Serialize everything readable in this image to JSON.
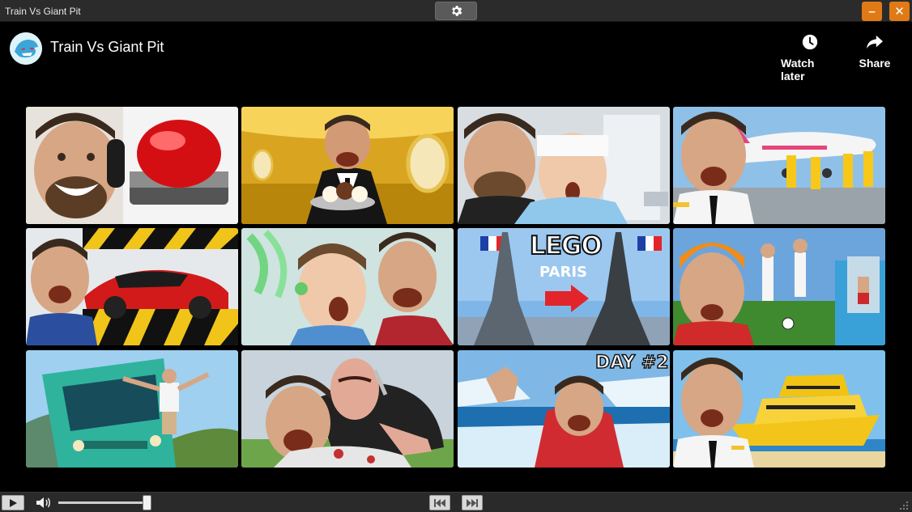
{
  "window": {
    "title": "Train Vs Giant Pit",
    "settings_icon": "gear-icon",
    "minimize_label": "–",
    "close_label": "✕",
    "accent_color": "#e07a16"
  },
  "player": {
    "video_title": "Train Vs Giant Pit",
    "actions": {
      "watch_later_label": "Watch later",
      "share_label": "Share"
    },
    "thumbnails": [
      {
        "icon": "red-button-thumbnail"
      },
      {
        "icon": "golden-jet-thumbnail"
      },
      {
        "icon": "hospital-thumbnail"
      },
      {
        "icon": "private-jet-thumbnail"
      },
      {
        "icon": "lamborghini-press-thumbnail"
      },
      {
        "icon": "hearing-aid-thumbnail"
      },
      {
        "icon": "lego-paris-thumbnail",
        "text_main": "LEGO",
        "text_sub": "PARIS"
      },
      {
        "icon": "soccer-thumbnail"
      },
      {
        "icon": "bus-thumbnail"
      },
      {
        "icon": "assassin-thumbnail"
      },
      {
        "icon": "ice-thumbnail",
        "badge": "DAY #2"
      },
      {
        "icon": "yacht-thumbnail"
      }
    ]
  },
  "controls": {
    "play_icon": "play-icon",
    "volume_icon": "speaker-icon",
    "volume_level": 0.95,
    "prev_icon": "skip-previous-icon",
    "next_icon": "skip-next-icon"
  }
}
